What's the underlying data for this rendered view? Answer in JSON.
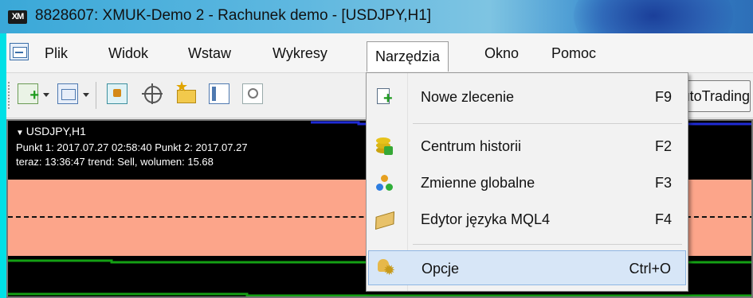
{
  "window": {
    "title": "8828607: XMUK-Demo 2 - Rachunek demo - [USDJPY,H1]",
    "logo": "XM"
  },
  "menubar": {
    "items": [
      {
        "label": "Plik"
      },
      {
        "label": "Widok"
      },
      {
        "label": "Wstaw"
      },
      {
        "label": "Wykresy"
      },
      {
        "label": "Narzędzia"
      },
      {
        "label": "Okno"
      },
      {
        "label": "Pomoc"
      }
    ],
    "active_index": 4
  },
  "toolbar": {
    "autotrading_label": "AutoTrading",
    "icons": [
      "new-chart-icon",
      "profiles-icon",
      "market-watch-icon",
      "crosshair-icon",
      "navigator-folder-icon",
      "terminal-panel-icon",
      "strategy-tester-icon"
    ]
  },
  "chart": {
    "symbol": "USDJPY,H1",
    "line1": "Punkt 1: 2017.07.27 02:58:40  Punkt 2: 2017.07.27",
    "line2": "teraz: 13:36:47  trend: Sell,  wolumen: 15.68",
    "colors": {
      "background": "#000000",
      "band": "#fca58a",
      "blue_line": "#1f2bd6",
      "green_line": "#14a014"
    }
  },
  "dropdown": {
    "items": [
      {
        "label": "Nowe zlecenie",
        "shortcut": "F9",
        "icon": "new-order-icon"
      },
      {
        "label": "Centrum historii",
        "shortcut": "F2",
        "icon": "history-center-icon"
      },
      {
        "label": "Zmienne globalne",
        "shortcut": "F3",
        "icon": "global-variables-icon"
      },
      {
        "label": "Edytor języka MQL4",
        "shortcut": "F4",
        "icon": "metaeditor-icon"
      },
      {
        "label": "Opcje",
        "shortcut": "Ctrl+O",
        "icon": "options-icon"
      }
    ],
    "highlighted_index": 4
  },
  "colors": {
    "accent_border": "#00e0e6",
    "hover": "#d7e6f7"
  }
}
